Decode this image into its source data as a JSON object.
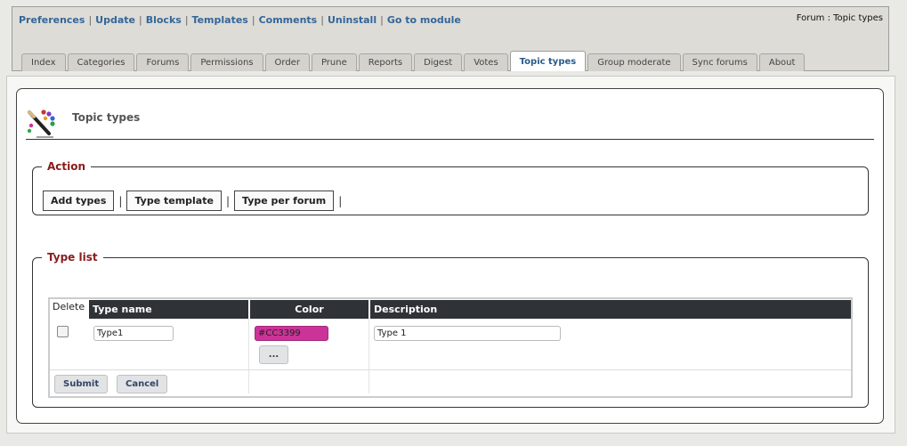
{
  "nav": {
    "links": [
      "Preferences",
      "Update",
      "Blocks",
      "Templates",
      "Comments",
      "Uninstall",
      "Go to module"
    ],
    "breadcrumb": "Forum : Topic types"
  },
  "tabs": [
    {
      "label": "Index",
      "active": false
    },
    {
      "label": "Categories",
      "active": false
    },
    {
      "label": "Forums",
      "active": false
    },
    {
      "label": "Permissions",
      "active": false
    },
    {
      "label": "Order",
      "active": false
    },
    {
      "label": "Prune",
      "active": false
    },
    {
      "label": "Reports",
      "active": false
    },
    {
      "label": "Digest",
      "active": false
    },
    {
      "label": "Votes",
      "active": false
    },
    {
      "label": "Topic types",
      "active": true
    },
    {
      "label": "Group moderate",
      "active": false
    },
    {
      "label": "Sync forums",
      "active": false
    },
    {
      "label": "About",
      "active": false
    }
  ],
  "page": {
    "title": "Topic types",
    "icon": "paint-palette-icon"
  },
  "action": {
    "legend": "Action",
    "buttons": [
      "Add types",
      "Type template",
      "Type per forum"
    ],
    "separator": "|"
  },
  "type_list": {
    "legend": "Type list",
    "headers": {
      "delete": "Delete",
      "name": "Type name",
      "color": "Color",
      "description": "Description"
    },
    "row": {
      "name": "Type1",
      "color": "#CC3399",
      "description": "Type 1",
      "picker_label": "...",
      "checked": false
    },
    "submit_label": "Submit",
    "cancel_label": "Cancel"
  },
  "colors": {
    "accent": "#336699",
    "legend": "#8a1b1b",
    "header_bg": "#2f3237",
    "swatch": "#cc3399"
  }
}
